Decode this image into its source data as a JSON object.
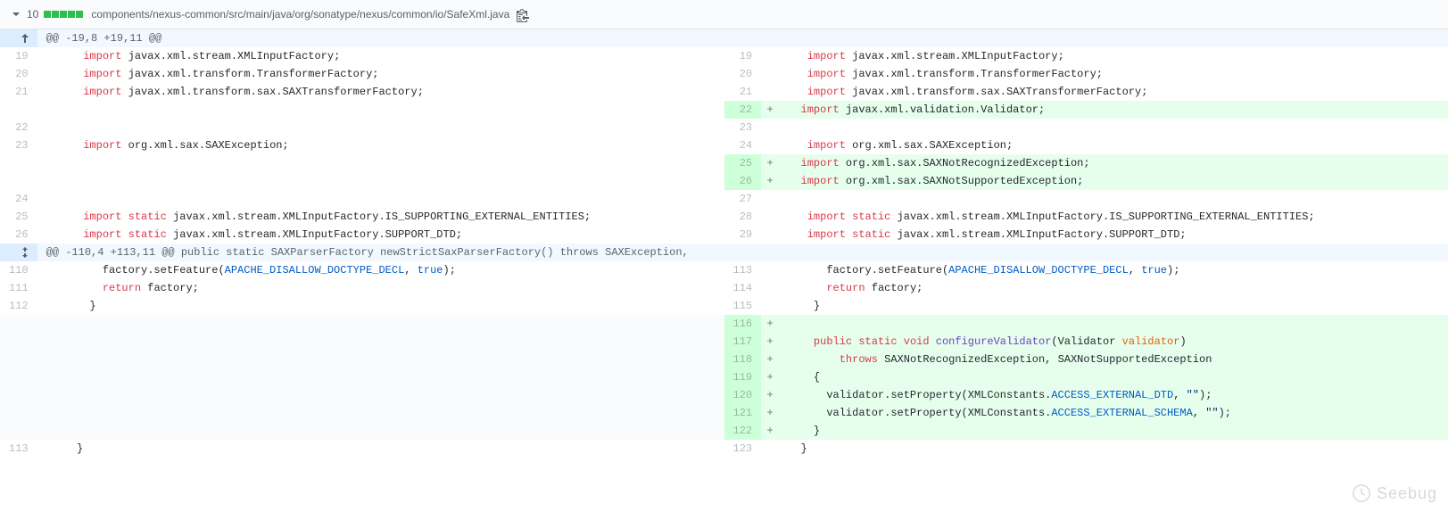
{
  "header": {
    "diff_count": "10",
    "file_path": "components/nexus-common/src/main/java/org/sonatype/nexus/common/io/SafeXml.java"
  },
  "hunks": {
    "h1": "@@ -19,8 +19,11 @@",
    "h2": "@@ -110,4 +113,11 @@ public static SAXParserFactory newStrictSaxParserFactory() throws SAXException,"
  },
  "line_nums": {
    "l19": "19",
    "l20": "20",
    "l21": "21",
    "l22": "22",
    "l23": "23",
    "l24": "24",
    "l25": "25",
    "l26": "26",
    "l27": "27",
    "l28": "28",
    "l29": "29",
    "l110": "110",
    "l111": "111",
    "l112": "112",
    "l113": "113",
    "l114": "114",
    "l115": "115",
    "l116": "116",
    "l117": "117",
    "l118": "118",
    "l119": "119",
    "l120": "120",
    "l121": "121",
    "l122": "122",
    "l123": "123"
  },
  "tok": {
    "import": "import",
    "import_static": "import static",
    "public": "public",
    "static": "static",
    "void": "void",
    "return": "return",
    "throws": "throws",
    "true": "true",
    "plus": "+",
    "empty_str": "\"\""
  },
  "code": {
    "xml_input_factory": " javax.xml.stream.XMLInputFactory;",
    "transformer_factory": " javax.xml.transform.TransformerFactory;",
    "sax_transformer_factory": " javax.xml.transform.sax.SAXTransformerFactory;",
    "validator": " javax.xml.validation.Validator;",
    "sax_exception": " org.xml.sax.SAXException;",
    "sax_not_recognized": " org.xml.sax.SAXNotRecognizedException;",
    "sax_not_supported": " org.xml.sax.SAXNotSupportedException;",
    "is_supporting_ext": " javax.xml.stream.XMLInputFactory.IS_SUPPORTING_EXTERNAL_ENTITIES;",
    "support_dtd": " javax.xml.stream.XMLInputFactory.SUPPORT_DTD;",
    "factory_set_feature_pre": "      factory.setFeature(",
    "apache_disallow": "APACHE_DISALLOW_DOCTYPE_DECL",
    "factory_set_feature_post": ");",
    "return_factory": " factory;",
    "close_brace": "    }",
    "conf_val_sig_pre": "    ",
    "conf_val_name": "configureValidator",
    "conf_val_sig_post": "(Validator ",
    "validator_param": "validator",
    "close_paren": ")",
    "throws_line": "        ",
    "throws_exc": " SAXNotRecognizedException, SAXNotSupportedException",
    "open_brace": "    {",
    "val_set_prop_pre": "      validator.setProperty(XMLConstants.",
    "access_ext_dtd": "ACCESS_EXTERNAL_DTD",
    "access_ext_schema": "ACCESS_EXTERNAL_SCHEMA",
    "val_set_prop_mid": ", ",
    "val_set_prop_post": ");",
    "outer_close": "  }",
    "comma_sp": ", "
  },
  "watermark": "Seebug"
}
